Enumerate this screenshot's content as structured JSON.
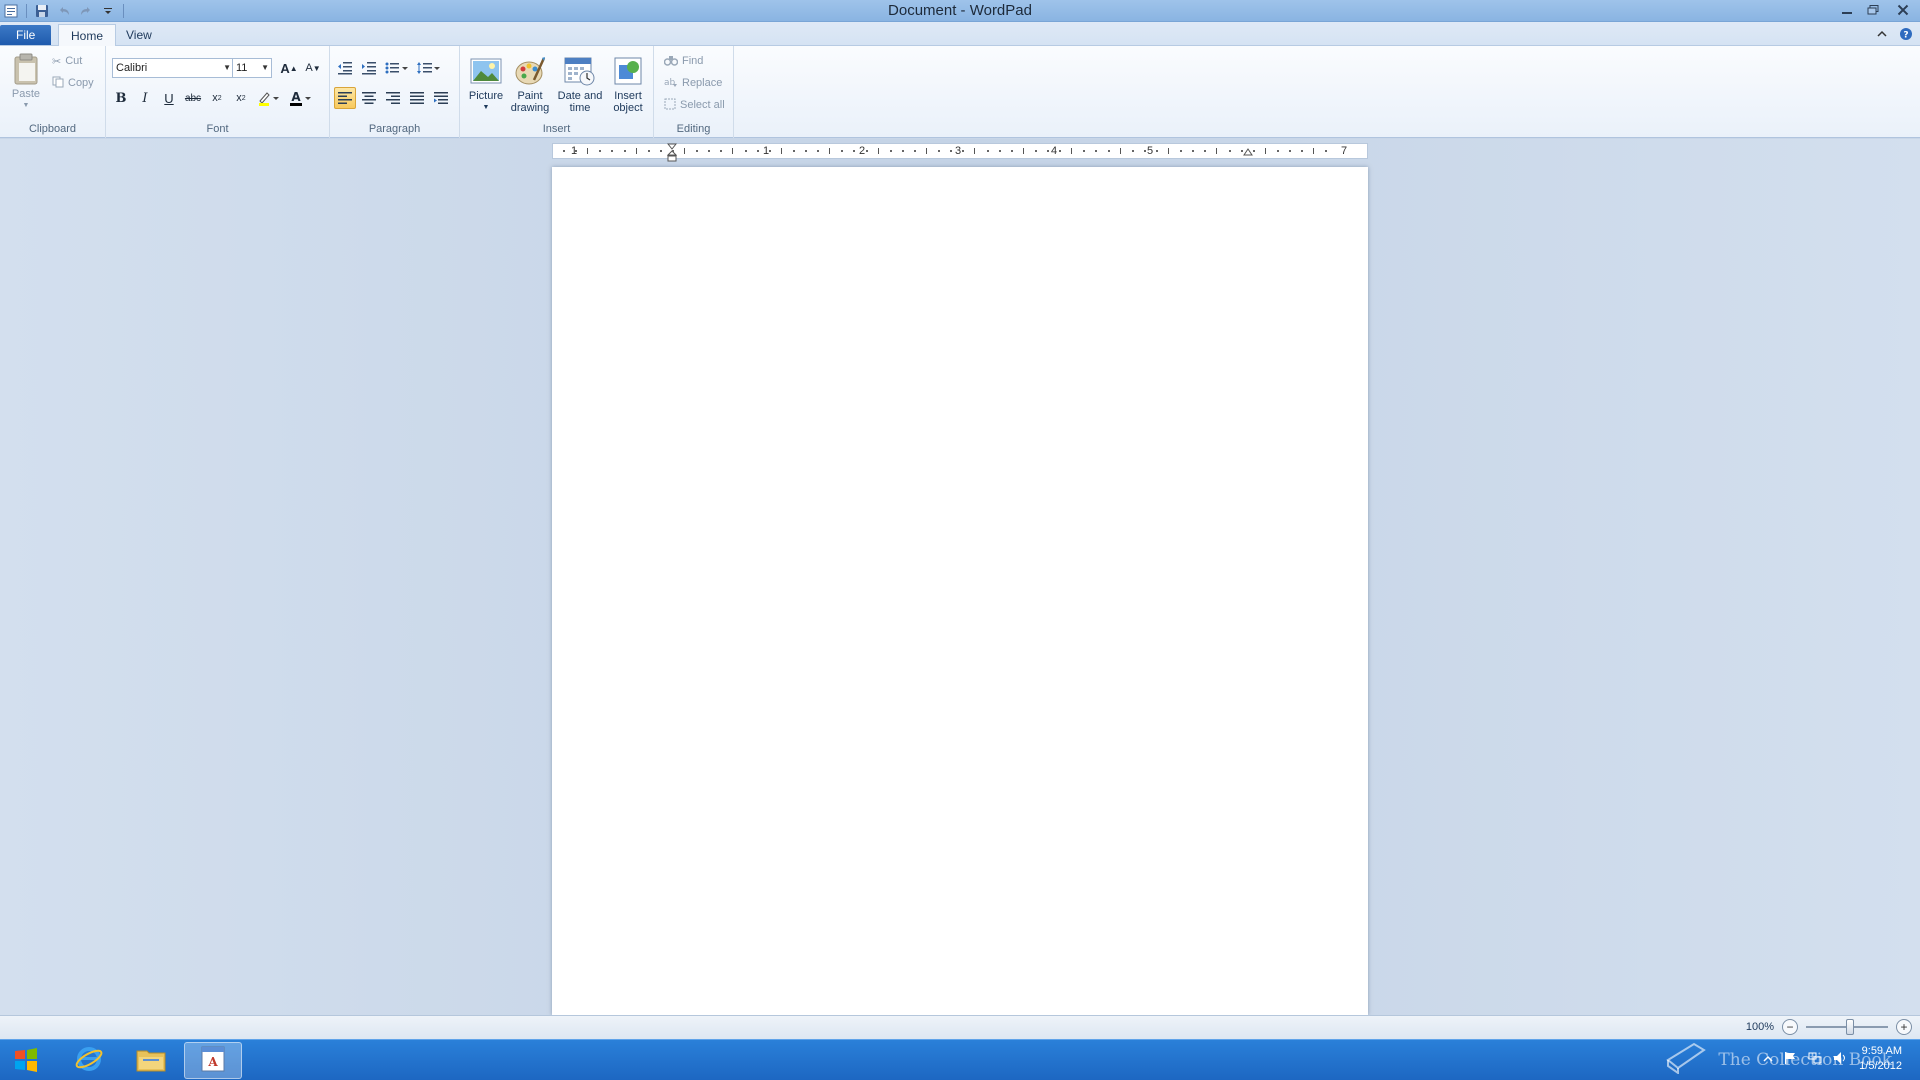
{
  "window": {
    "title": "Document - WordPad",
    "controls": [
      "minimize",
      "restore",
      "close"
    ]
  },
  "quick_access": [
    "wordpad-app-icon",
    "save-icon",
    "undo-icon",
    "redo-icon",
    "customize-qat-icon"
  ],
  "tabs": [
    {
      "label": "File"
    },
    {
      "label": "Home"
    },
    {
      "label": "View"
    }
  ],
  "ribbon": {
    "clipboard": {
      "paste_label": "Paste",
      "cut_label": "Cut",
      "copy_label": "Copy",
      "group_label": "Clipboard"
    },
    "font": {
      "family": "Calibri",
      "size": "11",
      "group_label": "Font",
      "buttons": [
        "grow-font",
        "shrink-font",
        "bold",
        "italic",
        "underline",
        "strikethrough",
        "subscript",
        "superscript",
        "highlight",
        "font-color"
      ],
      "font_color": "#000000",
      "highlight_color": "#ffff00"
    },
    "paragraph": {
      "group_label": "Paragraph",
      "active_alignment": "left"
    },
    "insert": {
      "picture_label": "Picture",
      "paint_label_1": "Paint",
      "paint_label_2": "drawing",
      "datetime_label_1": "Date and",
      "datetime_label_2": "time",
      "object_label_1": "Insert",
      "object_label_2": "object",
      "group_label": "Insert"
    },
    "editing": {
      "find_label": "Find",
      "replace_label": "Replace",
      "select_all_label": "Select all",
      "group_label": "Editing"
    }
  },
  "ruler": {
    "numbers": [
      "1",
      "1",
      "2",
      "3",
      "4",
      "5",
      "7"
    ]
  },
  "document": {
    "content": ""
  },
  "statusbar": {
    "zoom": "100%",
    "zoom_level": 1.0
  },
  "taskbar": {
    "apps": [
      "start-icon",
      "internet-explorer-icon",
      "file-explorer-icon",
      "wordpad-icon"
    ],
    "active_app": "wordpad-icon",
    "time": "9:59 AM",
    "date": "1/5/2012",
    "watermark": "The Collection Book"
  },
  "colors": {
    "titlebar": "#9fc3ea",
    "file_tab": "#2a68b8",
    "taskbar": "#2277cf",
    "active_align": "#f8c95d"
  }
}
